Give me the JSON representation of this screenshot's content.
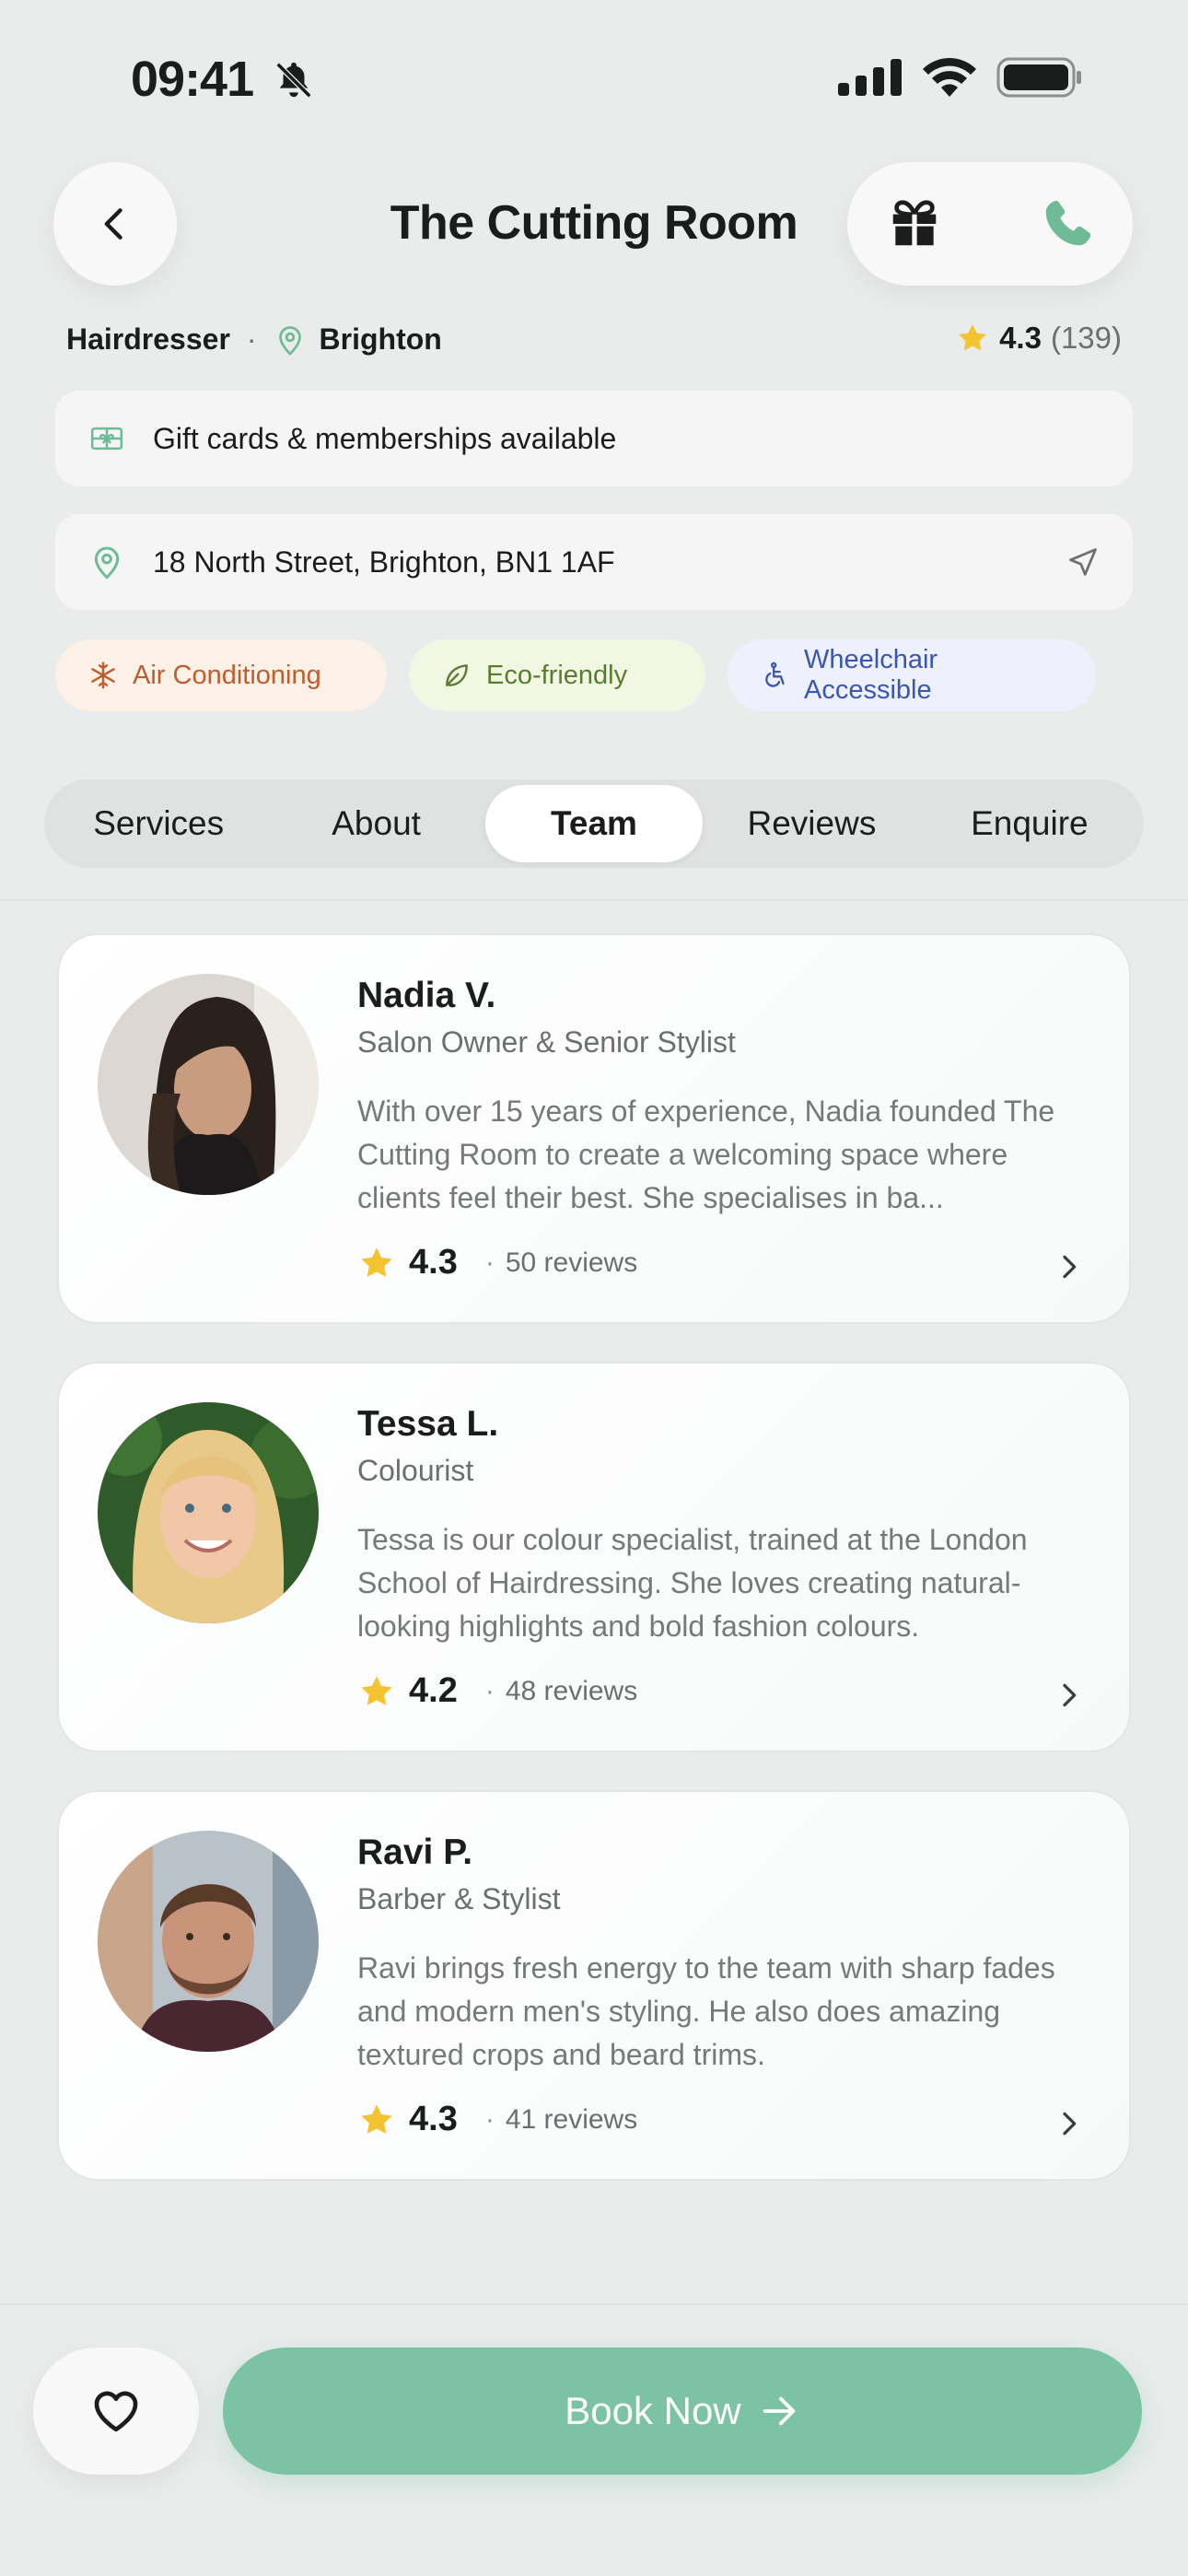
{
  "status_bar": {
    "time": "09:41"
  },
  "header": {
    "title": "The Cutting Room"
  },
  "meta": {
    "category": "Hairdresser",
    "location": "Brighton",
    "rating": "4.3",
    "rating_count": "(139)"
  },
  "info": {
    "gift_text": "Gift cards & memberships available",
    "address": "18 North Street, Brighton, BN1 1AF"
  },
  "amenities": [
    {
      "label": "Air Conditioning",
      "icon": "snowflake-icon",
      "color": "#bf5d2e"
    },
    {
      "label": "Eco-friendly",
      "icon": "leaf-icon",
      "color": "#597c2d"
    },
    {
      "label": "Wheelchair Accessible",
      "icon": "wheelchair-icon",
      "color": "#3a56b2"
    }
  ],
  "tabs": [
    {
      "label": "Services"
    },
    {
      "label": "About"
    },
    {
      "label": "Team",
      "active": true
    },
    {
      "label": "Reviews"
    },
    {
      "label": "Enquire"
    }
  ],
  "team": [
    {
      "name": "Nadia V.",
      "role": "Salon Owner & Senior Stylist",
      "bio": "With over 15 years of experience, Nadia founded The Cutting Room to create a welcoming space where clients feel their best. She specialises in ba...",
      "rating": "4.3",
      "reviews": "50 reviews"
    },
    {
      "name": "Tessa L.",
      "role": "Colourist",
      "bio": "Tessa is our colour specialist, trained at the London School of Hairdressing. She loves creating natural-looking highlights and bold fashion colours.",
      "rating": "4.2",
      "reviews": "48 reviews"
    },
    {
      "name": "Ravi P.",
      "role": "Barber & Stylist",
      "bio": "Ravi brings fresh energy to the team with sharp fades and modern men's styling. He also does amazing textured crops and beard trims.",
      "rating": "4.3",
      "reviews": "41 reviews"
    }
  ],
  "bottom": {
    "book_label": "Book Now"
  },
  "colors": {
    "accent": "#7cc2a4",
    "star": "#f4c430",
    "background": "#e9eceb"
  }
}
